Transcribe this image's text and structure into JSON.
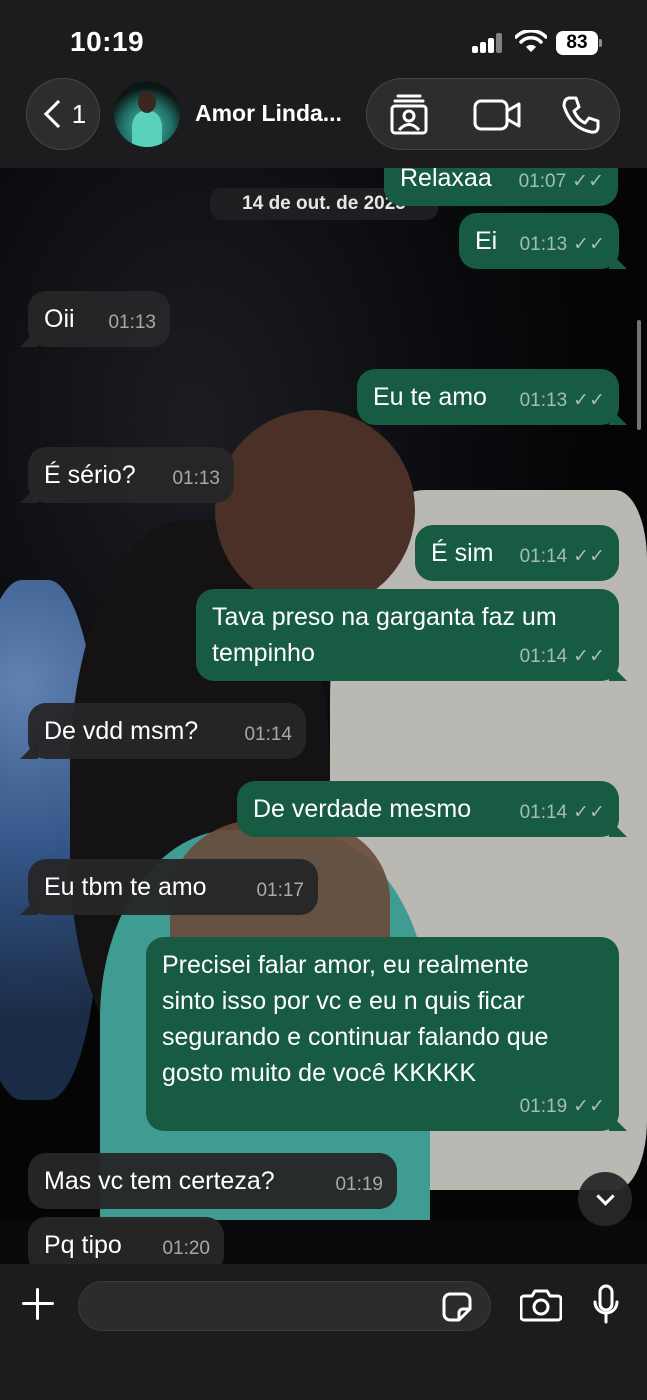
{
  "status_bar": {
    "time": "10:19",
    "battery": "83"
  },
  "header": {
    "back_count": "1",
    "contact_name": "Amor Linda..."
  },
  "date_chip": "14 de out. de 2025",
  "messages": [
    {
      "dir": "out",
      "text": "Relaxaa",
      "time": "01:07",
      "read": true
    },
    {
      "dir": "out",
      "text": "Ei",
      "time": "01:13",
      "read": true
    },
    {
      "dir": "in",
      "text": "Oii",
      "time": "01:13"
    },
    {
      "dir": "out",
      "text": "Eu te amo",
      "time": "01:13",
      "read": true
    },
    {
      "dir": "in",
      "text": "É sério?",
      "time": "01:13"
    },
    {
      "dir": "out",
      "text": "É sim",
      "time": "01:14",
      "read": true
    },
    {
      "dir": "out",
      "text": "Tava preso na garganta faz um\ntempinho",
      "time": "01:14",
      "read": true
    },
    {
      "dir": "in",
      "text": "De vdd msm?",
      "time": "01:14"
    },
    {
      "dir": "out",
      "text": "De verdade mesmo",
      "time": "01:14",
      "read": true
    },
    {
      "dir": "in",
      "text": "Eu tbm te amo",
      "time": "01:17"
    },
    {
      "dir": "out",
      "text": "Precisei falar amor, eu realmente\nsinto isso por vc e eu n quis ficar\nsegurando e continuar falando que\ngosto muito de você KKKKK",
      "time": "01:19",
      "read": true
    },
    {
      "dir": "in",
      "text": "Mas vc tem certeza?",
      "time": "01:19"
    },
    {
      "dir": "in",
      "text": "Pq tipo",
      "time": "01:20"
    }
  ],
  "input": {
    "placeholder": ""
  },
  "icons": {
    "back": "chevron-left-icon",
    "status_update": "contact-card-icon",
    "video_call": "video-camera-icon",
    "voice_call": "phone-icon",
    "attach": "plus-icon",
    "sticker": "sticker-icon",
    "camera": "camera-icon",
    "mic": "microphone-icon",
    "scroll_down": "chevron-down-icon"
  },
  "colors": {
    "outgoing_bubble": "#175b43",
    "incoming_bubble": "#262628",
    "bar": "#1c1c1e"
  }
}
